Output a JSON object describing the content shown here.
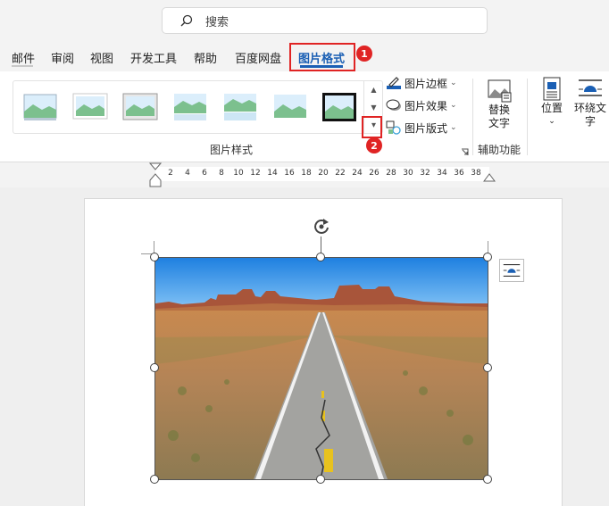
{
  "search": {
    "placeholder": "搜索"
  },
  "tabs": [
    "邮件",
    "审阅",
    "视图",
    "开发工具",
    "帮助",
    "百度网盘",
    "图片格式"
  ],
  "active_tab": "图片格式",
  "badges": [
    "1",
    "2"
  ],
  "ribbon": {
    "picture_styles": {
      "group_label": "图片样式",
      "commands": [
        {
          "label": "图片边框",
          "icon": "pen-border-icon"
        },
        {
          "label": "图片效果",
          "icon": "effects-icon"
        },
        {
          "label": "图片版式",
          "icon": "layout-icon"
        }
      ]
    },
    "accessibility": {
      "group_label": "辅助功能",
      "alt_text_label_1": "替换",
      "alt_text_label_2": "文字"
    },
    "arrange": {
      "position_label": "位置",
      "wrap_text_label_1": "环绕文",
      "wrap_text_label_2": "字"
    }
  },
  "ruler": {
    "ticks": [
      "2",
      "4",
      "6",
      "8",
      "10",
      "12",
      "14",
      "16",
      "18",
      "20",
      "22",
      "24",
      "26",
      "28",
      "30",
      "32",
      "34",
      "36",
      "38"
    ]
  },
  "colors": {
    "accent": "#1a5fb4",
    "highlight": "#e02424"
  }
}
